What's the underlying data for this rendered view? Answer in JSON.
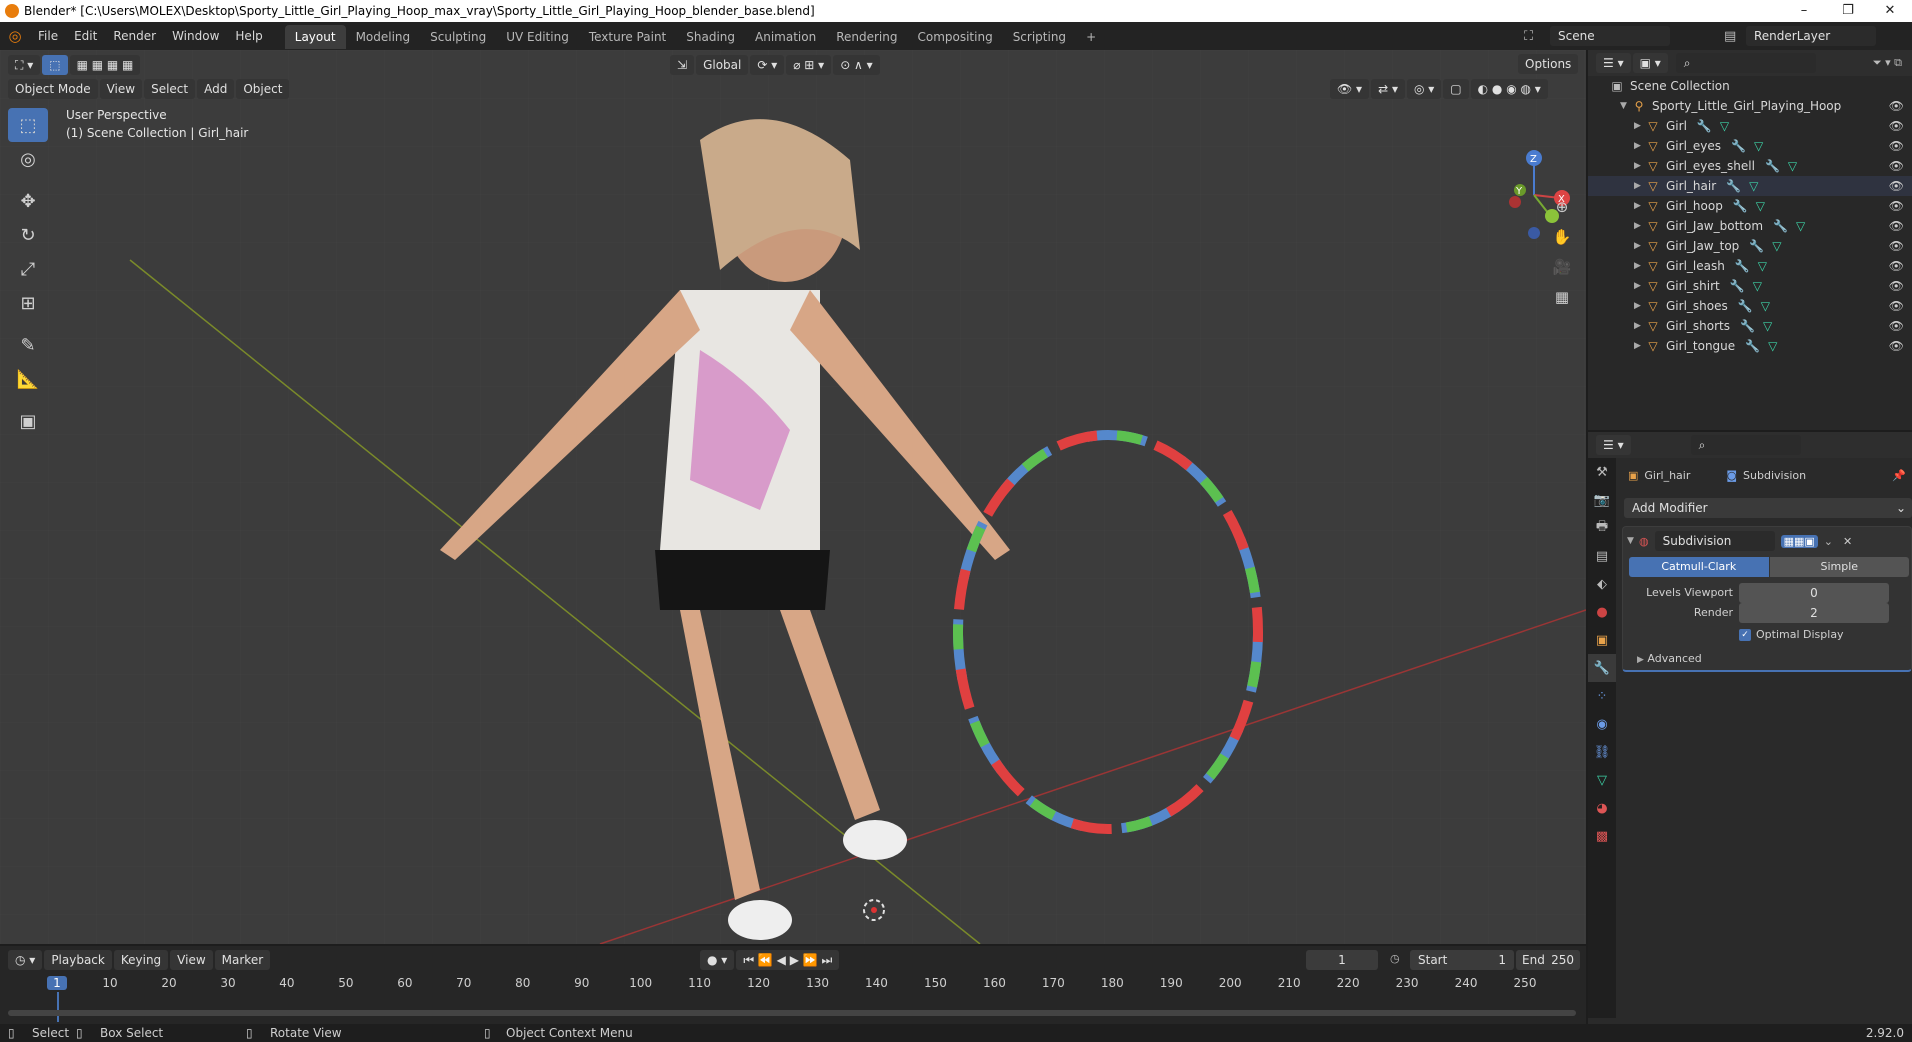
{
  "window": {
    "title": "Blender* [C:\\Users\\MOLEX\\Desktop\\Sporty_Little_Girl_Playing_Hoop_max_vray\\Sporty_Little_Girl_Playing_Hoop_blender_base.blend]",
    "minimize": "–",
    "maximize": "❐",
    "close": "✕"
  },
  "menu": {
    "items": [
      "File",
      "Edit",
      "Render",
      "Window",
      "Help"
    ],
    "workspaces": [
      "Layout",
      "Modeling",
      "Sculpting",
      "UV Editing",
      "Texture Paint",
      "Shading",
      "Animation",
      "Rendering",
      "Compositing",
      "Scripting"
    ],
    "active_workspace": "Layout",
    "add_workspace": "+",
    "scene": "Scene",
    "render_layer": "RenderLayer"
  },
  "viewport": {
    "mode": "Object Mode",
    "menus": [
      "View",
      "Select",
      "Add",
      "Object"
    ],
    "transform_orientation": "Global",
    "options": "Options",
    "perspective_label": "User Perspective",
    "collection_label": "(1) Scene Collection | Girl_hair",
    "gizmo_axes": {
      "x": "X",
      "y": "Y",
      "z": "Z"
    }
  },
  "outliner": {
    "root": "Scene Collection",
    "collection": "Sporty_Little_Girl_Playing_Hoop",
    "objects": [
      "Girl",
      "Girl_eyes",
      "Girl_eyes_shell",
      "Girl_hair",
      "Girl_hoop",
      "Girl_Jaw_bottom",
      "Girl_Jaw_top",
      "Girl_leash",
      "Girl_shirt",
      "Girl_shoes",
      "Girl_shorts",
      "Girl_tongue"
    ],
    "selected": "Girl_hair"
  },
  "properties": {
    "object": "Girl_hair",
    "modifier_context": "Subdivision",
    "add_modifier": "Add Modifier",
    "modifier_name": "Subdivision",
    "algorithms": [
      "Catmull-Clark",
      "Simple"
    ],
    "active_algorithm": "Catmull-Clark",
    "levels_viewport_label": "Levels Viewport",
    "levels_viewport": "0",
    "render_label": "Render",
    "render": "2",
    "optimal_display": "Optimal Display",
    "advanced": "Advanced"
  },
  "timeline": {
    "menus": [
      "Playback",
      "Keying",
      "View",
      "Marker"
    ],
    "current_frame": "1",
    "start_label": "Start",
    "start": "1",
    "end_label": "End",
    "end": "250",
    "ticks": [
      "1",
      "10",
      "20",
      "30",
      "40",
      "50",
      "60",
      "70",
      "80",
      "90",
      "100",
      "110",
      "120",
      "130",
      "140",
      "150",
      "160",
      "170",
      "180",
      "190",
      "200",
      "210",
      "220",
      "230",
      "240",
      "250"
    ]
  },
  "statusbar": {
    "select": "Select",
    "box_select": "Box Select",
    "rotate_view": "Rotate View",
    "context_menu": "Object Context Menu",
    "version": "2.92.0"
  },
  "colors": {
    "accent": "#4772b3",
    "orange": "#e87d0d",
    "viewport": "#3c3c3c"
  }
}
